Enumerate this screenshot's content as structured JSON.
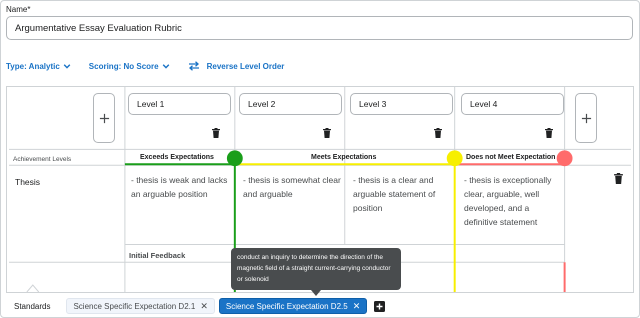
{
  "name_field": {
    "label": "Name*",
    "value": "Argumentative Essay Evaluation Rubric"
  },
  "options": {
    "type_label": "Type: Analytic",
    "scoring_label": "Scoring: No Score",
    "reverse_label": "Reverse Level Order"
  },
  "levels": [
    {
      "name": "Level 1"
    },
    {
      "name": "Level 2"
    },
    {
      "name": "Level 3"
    },
    {
      "name": "Level 4"
    }
  ],
  "achievement_levels_label": "Achievement Levels",
  "ranges": {
    "exceeds": "Exceeds Expectations",
    "meets": "Meets Expectations",
    "not_meet": "Does not Meet Expectation"
  },
  "colors": {
    "exceeds": "#1a9e1a",
    "meets": "#f7ef00",
    "not_meet": "#ff6b6b",
    "accent": "#1a73c6"
  },
  "criterion": {
    "name": "Thesis",
    "descriptions": [
      "- thesis is weak and lacks an arguable position",
      "- thesis is somewhat clear and arguable",
      "- thesis is a clear and arguable statement of position",
      "- thesis is exceptionally clear, arguable, well developed, and a definitive statement"
    ]
  },
  "initial_feedback_label": "Initial Feedback",
  "tooltip": "conduct an inquiry to determine the direction of the magnetic field of a straight current-carrying conductor or solenoid",
  "standards": {
    "label": "Standards",
    "chips": [
      {
        "label": "Science Specific Expectation D2.1",
        "active": false
      },
      {
        "label": "Science Specific Expectation D2.5",
        "active": true
      }
    ]
  },
  "icons": [
    "chevron-down-icon",
    "swap-icon",
    "plus-icon",
    "trash-icon",
    "close-icon",
    "add-square-icon"
  ]
}
